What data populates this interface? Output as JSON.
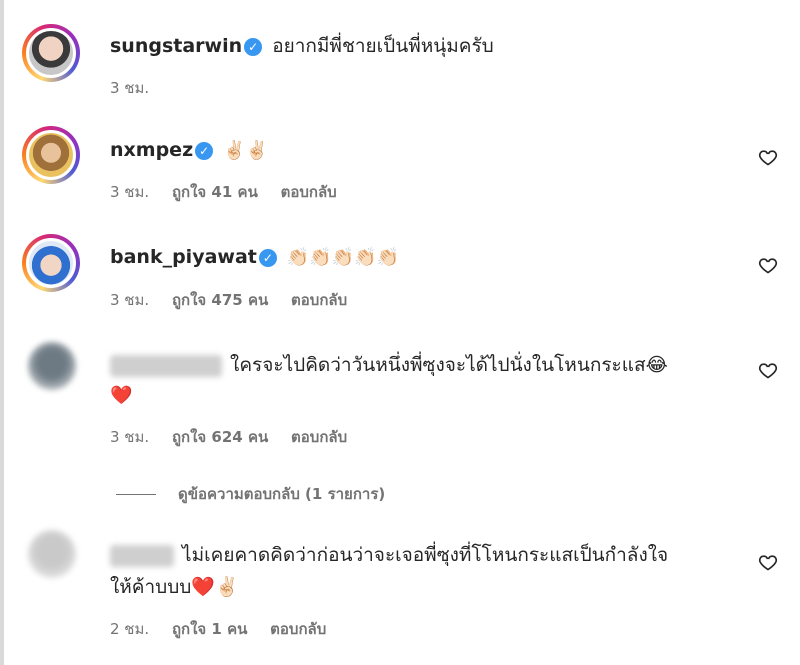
{
  "comments": [
    {
      "username": "sungstarwin",
      "verified": true,
      "text": "อยากมีพี่ชายเป็นพี่หนุ่มครับ",
      "time": "3 ชม.",
      "likes": "",
      "reply": ""
    },
    {
      "username": "nxmpez",
      "verified": true,
      "text": "✌🏻✌🏻",
      "time": "3 ชม.",
      "likes": "ถูกใจ 41 คน",
      "reply": "ตอบกลับ"
    },
    {
      "username": "bank_piyawat",
      "verified": true,
      "text": "👏🏻👏🏻👏🏻👏🏻👏🏻",
      "time": "3 ชม.",
      "likes": "ถูกใจ 475 คน",
      "reply": "ตอบกลับ"
    },
    {
      "username": "",
      "verified": false,
      "text_line1": "ใครจะไปคิดว่าวันหนึ่งพี่ซุงจะได้ไปนั่งในโหนกระแส😂",
      "text_line2": "❤️",
      "time": "3 ชม.",
      "likes": "ถูกใจ 624 คน",
      "reply": "ตอบกลับ",
      "view_replies": "ดูข้อความตอบกลับ (1 รายการ)"
    },
    {
      "username": "",
      "verified": false,
      "text_line1": "ไม่เคยคาดคิดว่าก่อนว่าจะเจอพี่ซุงที่โโหนกระแสเป็นกำลังใจ",
      "text_line2": "ให้ค้าบบบ❤️✌🏻",
      "time": "2 ชม.",
      "likes": "ถูกใจ 1 คน",
      "reply": "ตอบกลับ"
    }
  ],
  "icons": {
    "like": "heart-outline-icon",
    "verified": "verified-badge-icon"
  },
  "colors": {
    "verified": "#3897f0",
    "secondary_text": "#737373"
  }
}
